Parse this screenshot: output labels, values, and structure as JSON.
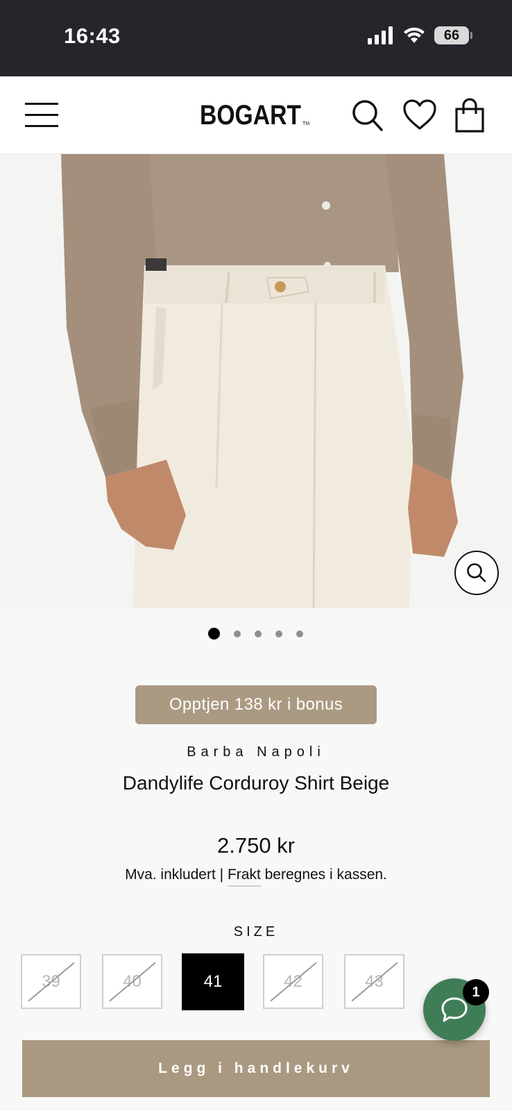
{
  "status_bar": {
    "time": "16:43",
    "battery": "66"
  },
  "header": {
    "logo_text": "BOGART"
  },
  "gallery": {
    "slide_count": 5,
    "active_index": 0
  },
  "promo": {
    "bonus_text": "Opptjen 138 kr i bonus"
  },
  "product": {
    "brand": "Barba Napoli",
    "title": "Dandylife Corduroy Shirt Beige",
    "price": "2.750 kr",
    "tax_prefix": "Mva. inkludert | ",
    "shipping_link": "Frakt",
    "tax_suffix": " beregnes i kassen."
  },
  "size_selector": {
    "label": "SIZE",
    "options": [
      {
        "label": "39",
        "available": false
      },
      {
        "label": "40",
        "available": false
      },
      {
        "label": "41",
        "available": true,
        "selected": true
      },
      {
        "label": "42",
        "available": false
      },
      {
        "label": "43",
        "available": false
      }
    ]
  },
  "cart": {
    "add_label": "Legg i handlekurv"
  },
  "chat": {
    "badge_count": "1"
  },
  "colors": {
    "accent": "#a99981",
    "chat_green": "#3f7d57",
    "status_bar": "#24262b"
  }
}
